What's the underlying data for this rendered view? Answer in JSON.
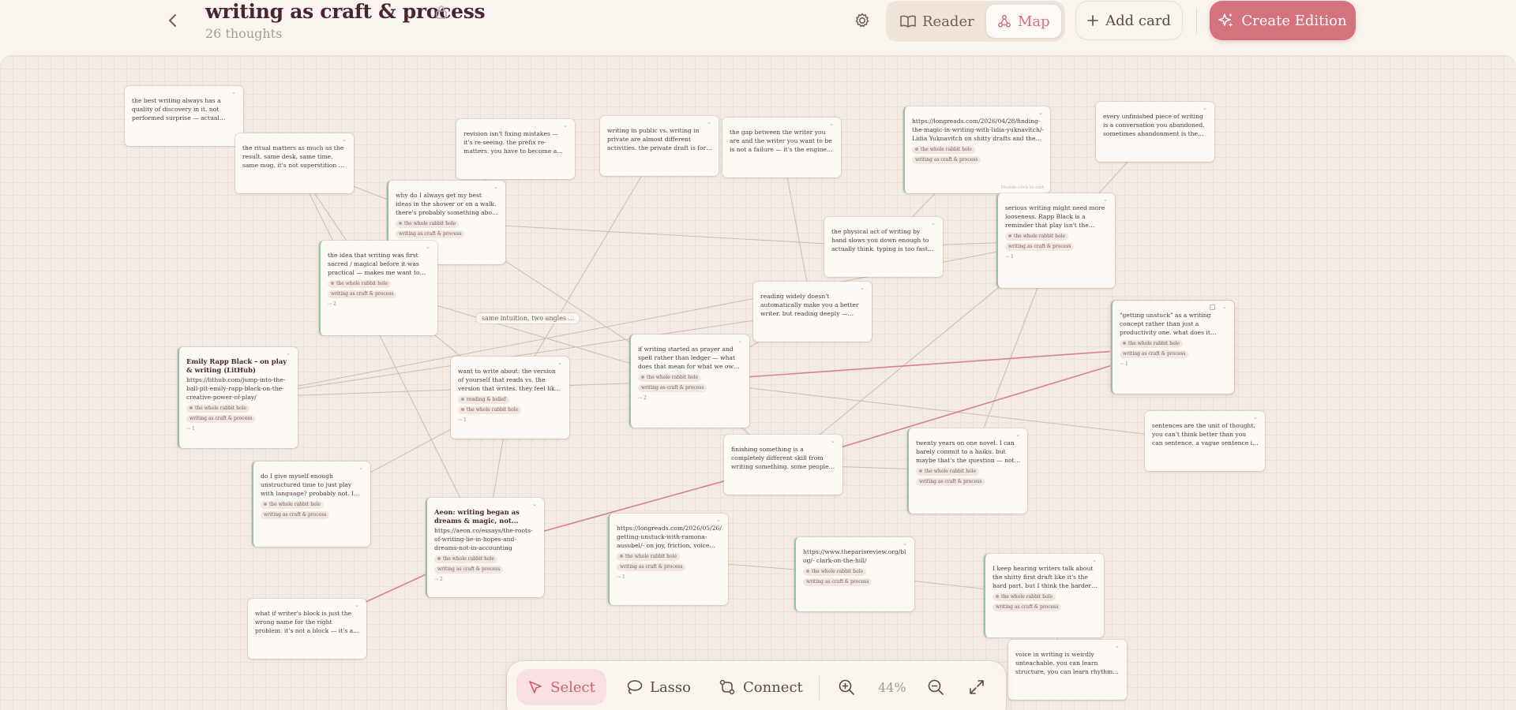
{
  "header": {
    "back_icon": "chevron-left-icon",
    "title": "writing as craft & process",
    "lock_icon": "lock-icon",
    "subtitle": "26 thoughts",
    "settings_icon": "gear-icon",
    "view_tabs": [
      {
        "label": "Reader",
        "icon": "book-open-icon",
        "active": false
      },
      {
        "label": "Map",
        "icon": "network-icon",
        "active": true
      }
    ],
    "add_card_label": "Add card",
    "create_edition_label": "Create Edition"
  },
  "colors": {
    "accent": "#d4727e",
    "accent_soft": "#f8dfe2",
    "card_border_tagged": "#9bbfa7",
    "edge": "#c9bcb4",
    "edge_highlight": "#d9828e"
  },
  "cards": [
    {
      "id": "c1",
      "body": "the best writing always has a quality of discovery in it. not performed surprise — actual discovery. the writer figurin..."
    },
    {
      "id": "c2",
      "body": "the ritual matters as much as the result. same desk, same time, same mug. it's not superstition — it's trainin..."
    },
    {
      "id": "c3",
      "body": "revision isn't fixing mistakes — it's re-seeing. the prefix re- matters. you have to become a different reader of your..."
    },
    {
      "id": "c4",
      "body": "writing in public vs. writing in private are almost different activities. the private draft is for thinking. the..."
    },
    {
      "id": "c5",
      "body": "the gap between the writer you are and the writer you want to be is not a failure — it's the engine. Ira Glass call..."
    },
    {
      "id": "c6",
      "body": "https://longreads.com/2026/04/28/finding-the-magic-in-writing-with-lidia-yuknavitch/- Lidia Yuknavitch on shitty drafts and the struggle (Longreads)",
      "tags": [
        "the whole rabbit hole",
        "writing as craft & process"
      ],
      "hint": "Double-click to edit"
    },
    {
      "id": "c7",
      "body": "every unfinished piece of writing is a conversation you abandoned. sometimes abandonment is the right..."
    },
    {
      "id": "c8",
      "body": "why do I always get my best ideas in the shower or on a walk. there's probably something about movemen...",
      "tags": [
        "the whole rabbit hole",
        "writing as craft & process"
      ]
    },
    {
      "id": "c9",
      "body": "serious writing might need more looseness. Rapp Black is a reminder that play isn't the opposite of rigor — ...",
      "tags": [
        "the whole rabbit hole",
        "writing as craft & process"
      ],
      "count": "1"
    },
    {
      "id": "c10",
      "body": "the physical act of writing by hand slows you down enough to actually think. typing is too fast for thought..."
    },
    {
      "id": "c11",
      "body": "the idea that writing was first sacred / magical before it was practical — makes me want to write something...",
      "tags": [
        "the whole rabbit hole",
        "writing as craft & process"
      ],
      "count": "2"
    },
    {
      "id": "c12",
      "body": "reading widely doesn't automatically make you a better writer. but reading deeply — slowly, attentively, asking..."
    },
    {
      "id": "c13",
      "body": "\"getting unstuck\" as a writing concept rather than just a productivity one. what does it mean to be stuck in your...",
      "tags": [
        "the whole rabbit hole",
        "writing as craft & process"
      ],
      "count": "1"
    },
    {
      "id": "c14",
      "title": "Emily Rapp Black – on play & writing (LitHub)",
      "body": "https://lithub.com/jump-into-the-ball-pit-emily-rapp-black-on-the-creative-power-of-play/",
      "tags": [
        "the whole rabbit hole",
        "writing as craft & process"
      ],
      "count": "1"
    },
    {
      "id": "c15",
      "body": "if writing started as prayer and spell rather than ledger — what does that mean for what we owe it? maybe eve...",
      "tags": [
        "the whole rabbit hole",
        "writing as craft & process"
      ],
      "count": "2"
    },
    {
      "id": "c16",
      "body": "want to write about: the version of yourself that reads vs. the version that writes. they feel like different people...",
      "tags": [
        "reading & belief",
        "the whole rabbit hole"
      ],
      "count": "1"
    },
    {
      "id": "c17",
      "body": "sentences are the unit of thought. you can't think better than you can sentence. a vague sentence is a vague..."
    },
    {
      "id": "c18",
      "body": "finishing something is a completely different skill from writing something. some people are great starters — the..."
    },
    {
      "id": "c19",
      "body": "twenty years on one novel. I can barely commit to a haiku. but maybe that's the question — not whether you can...",
      "tags": [
        "the whole rabbit hole",
        "writing as craft & process"
      ]
    },
    {
      "id": "c20",
      "body": "do I give myself enough unstructured time to just play with language? probably not. I always need a goal, a...",
      "tags": [
        "the whole rabbit hole",
        "writing as craft & process"
      ]
    },
    {
      "id": "c21",
      "title": "Aeon: writing began as dreams & magic, not...",
      "body": "https://aeon.co/essays/the-roots-of-writing-lie-in-hopes-and-dreams-not-in-accounting",
      "tags": [
        "the whole rabbit hole",
        "writing as craft & process"
      ],
      "count": "2"
    },
    {
      "id": "c22",
      "body": "https://longreads.com/2026/05/26/getting-unstuck-with-ramona-ausubel/- on joy, friction, voice (Longreads)",
      "tags": [
        "the whole rabbit hole",
        "writing as craft & process"
      ],
      "count": "1"
    },
    {
      "id": "c23",
      "body": "https://www.theparisreview.org/blog/- clark-on-the-hill/",
      "tags": [
        "the whole rabbit hole",
        "writing as craft & process"
      ]
    },
    {
      "id": "c24",
      "body": "I keep hearing writers talk about the shitty first draft like it's the hard part. but I think the harder part is the shit...",
      "tags": [
        "the whole rabbit hole",
        "writing as craft & process"
      ]
    },
    {
      "id": "c25",
      "body": "what if writer's block is just the wrong name for the right problem. it's not a block — it's a signal that you don't yet..."
    },
    {
      "id": "c26",
      "body": "voice in writing is weirdly unteachable. you can learn structure, you can learn rhythm. but voice seems to emerge..."
    }
  ],
  "edge_labels": [
    "same intuition, two angles ..."
  ],
  "toolbar": {
    "select_label": "Select",
    "lasso_label": "Lasso",
    "connect_label": "Connect",
    "zoom_level": "44%",
    "zoom_in_icon": "zoom-in-icon",
    "zoom_out_icon": "zoom-out-icon",
    "fit_icon": "expand-icon"
  }
}
